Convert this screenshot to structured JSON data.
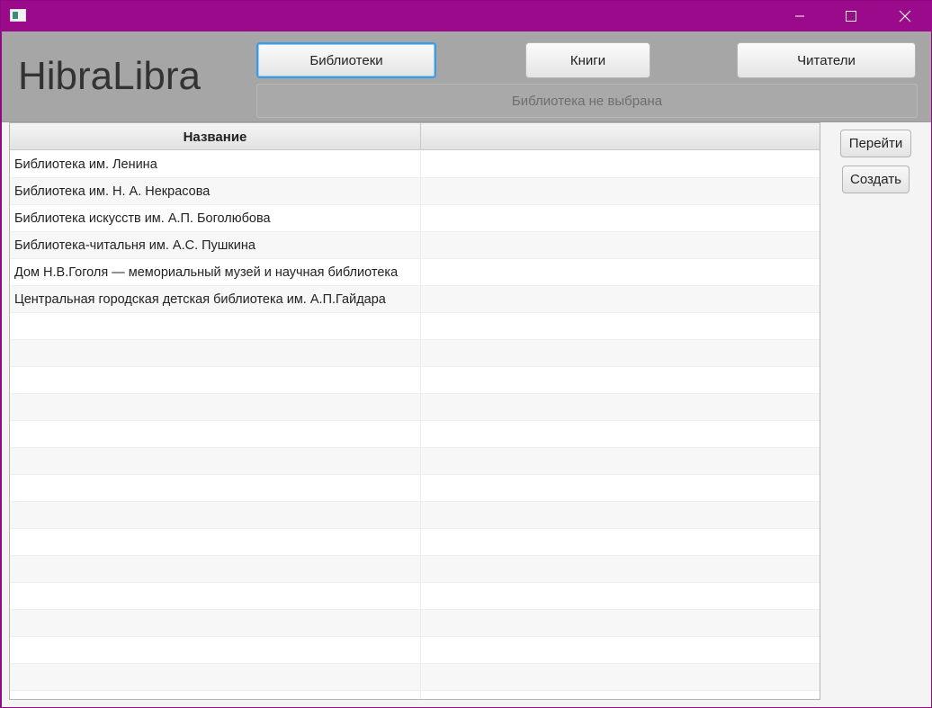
{
  "window": {
    "app_icon": "app-window-icon",
    "controls": {
      "minimize_icon": "minimize-icon",
      "maximize_icon": "maximize-icon",
      "close_icon": "close-icon"
    }
  },
  "header": {
    "app_title": "HibraLibra",
    "nav": {
      "libraries_label": "Библиотеки",
      "books_label": "Книги",
      "readers_label": "Читатели",
      "active": "libraries"
    },
    "selected_library_text": "Библиотека не выбрана"
  },
  "table": {
    "columns": [
      "Название",
      ""
    ],
    "rows": [
      {
        "name": "Библиотека им. Ленина",
        "extra": ""
      },
      {
        "name": "Библиотека им. Н. А. Некрасова",
        "extra": ""
      },
      {
        "name": "Библиотека искусств им. А.П. Боголюбова",
        "extra": ""
      },
      {
        "name": "Библиотека-читальня им. А.С. Пушкина",
        "extra": ""
      },
      {
        "name": "Дом Н.В.Гоголя — мемориальный музей и научная библиотека",
        "extra": ""
      },
      {
        "name": "Центральная городская детская библиотека им. А.П.Гайдара",
        "extra": ""
      }
    ]
  },
  "actions": {
    "goto_label": "Перейти",
    "create_label": "Создать"
  },
  "colors": {
    "titlebar": "#9b0a8a",
    "header_bg": "#a6a6a6",
    "active_border": "#3b9be3"
  }
}
